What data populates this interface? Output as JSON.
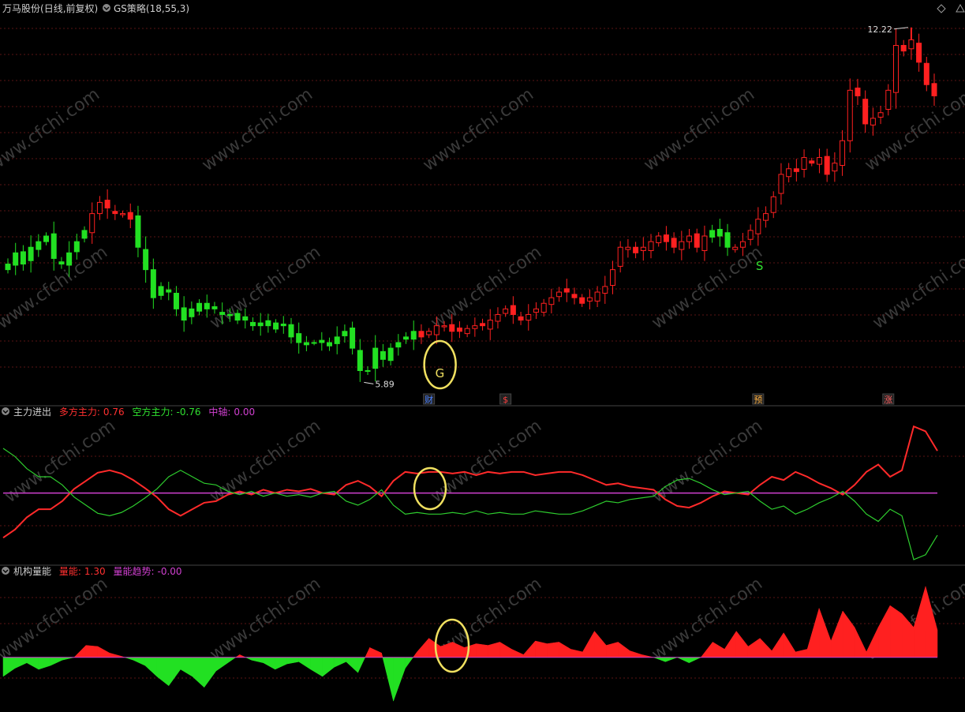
{
  "colors": {
    "up": "#ff2020",
    "down": "#22e022",
    "text": "#cfcfcf",
    "magenta": "#d040d0",
    "grid": "#5a1414",
    "circle": "#f0e060",
    "watermark": "#3a3a3a"
  },
  "header": {
    "stock_name": "万马股份",
    "period": "(日线,前复权)",
    "indicator_name": "GS策略",
    "indicator_params": "(18,55,3)"
  },
  "price_pane": {
    "high_label": "12.22",
    "low_label": "5.89",
    "signal_g": "G",
    "signal_s": "S",
    "event_markers": [
      {
        "label": "财",
        "day": 55
      },
      {
        "label": "$",
        "day": 65
      },
      {
        "label": "预",
        "day": 98
      },
      {
        "label": "涨",
        "day": 115
      }
    ]
  },
  "pane2": {
    "title": "主力进出",
    "items": [
      {
        "label": "多方主力:",
        "value": "0.76",
        "color": "#ff3030"
      },
      {
        "label": "空方主力:",
        "value": "-0.76",
        "color": "#30e030"
      },
      {
        "label": "中轴:",
        "value": "0.00",
        "color": "#d040d0"
      }
    ]
  },
  "pane3": {
    "title": "机构量能",
    "items": [
      {
        "label": "量能:",
        "value": "1.30",
        "color": "#ff3030"
      },
      {
        "label": "量能趋势:",
        "value": "-0.00",
        "color": "#d040d0"
      }
    ]
  },
  "watermark": "www.cfchi.com",
  "chart_data": [
    {
      "type": "candlestick",
      "title": "GS策略(18,55,3)",
      "series": [
        {
          "name": "close",
          "values": [
            8.0,
            8.2,
            8.0,
            8.3,
            8.4,
            8.5,
            8.1,
            8.0,
            8.2,
            8.4,
            8.6,
            8.9,
            9.1,
            9.0,
            8.9,
            8.9,
            8.8,
            8.3,
            7.9,
            7.4,
            7.6,
            7.5,
            7.2,
            7.0,
            7.2,
            7.3,
            7.2,
            7.2,
            7.1,
            7.1,
            7.0,
            7.0,
            6.9,
            6.95,
            6.9,
            6.95,
            6.9,
            6.7,
            6.6,
            6.6,
            6.6,
            6.6,
            6.6,
            6.7,
            6.8,
            6.5,
            6.1,
            6.1,
            6.5,
            6.3,
            6.5,
            6.6,
            6.7,
            6.8,
            6.7,
            6.8,
            6.9,
            6.9,
            6.8,
            6.8,
            6.85,
            6.9,
            6.9,
            7.0,
            7.1,
            7.2,
            7.1,
            7.0,
            7.1,
            7.2,
            7.3,
            7.4,
            7.5,
            7.5,
            7.4,
            7.3,
            7.4,
            7.5,
            7.6,
            7.9,
            8.3,
            8.3,
            8.2,
            8.3,
            8.4,
            8.5,
            8.4,
            8.3,
            8.4,
            8.5,
            8.3,
            8.5,
            8.6,
            8.5,
            8.3,
            8.3,
            8.4,
            8.6,
            8.8,
            8.9,
            9.2,
            9.6,
            9.7,
            9.65,
            9.9,
            9.8,
            9.9,
            9.6,
            9.8,
            10.2,
            11.1,
            11.0,
            10.5,
            10.6,
            10.7,
            11.1,
            11.9,
            11.8,
            12.0,
            11.6,
            11.2,
            11.0
          ]
        },
        {
          "name": "signal",
          "values": [
            "down",
            "down",
            "down",
            "down",
            "down",
            "down",
            "down",
            "down",
            "down",
            "down",
            "down",
            "up",
            "up",
            "up",
            "up",
            "up",
            "up",
            "down",
            "down",
            "down",
            "down",
            "down",
            "down",
            "down",
            "down",
            "down",
            "down",
            "down",
            "down",
            "down",
            "down",
            "down",
            "down",
            "down",
            "down",
            "down",
            "down",
            "down",
            "down",
            "down",
            "down",
            "down",
            "down",
            "down",
            "down",
            "down",
            "down",
            "down",
            "down",
            "down",
            "down",
            "down",
            "down",
            "down",
            "up",
            "up",
            "up",
            "up",
            "up",
            "up",
            "up",
            "up",
            "up",
            "up",
            "up",
            "up",
            "up",
            "up",
            "up",
            "up",
            "up",
            "up",
            "up",
            "up",
            "up",
            "up",
            "up",
            "up",
            "up",
            "up",
            "up",
            "up",
            "up",
            "up",
            "up",
            "up",
            "up",
            "up",
            "up",
            "up",
            "up",
            "up",
            "down",
            "down",
            "down",
            "up",
            "up",
            "up",
            "up",
            "up",
            "up",
            "up",
            "up",
            "up",
            "up",
            "up",
            "up",
            "up",
            "up",
            "up",
            "up",
            "up",
            "up",
            "up",
            "up",
            "up",
            "up",
            "up",
            "up",
            "up",
            "up",
            "up"
          ]
        }
      ],
      "ylim": [
        5.6,
        12.4
      ],
      "high": 12.22,
      "low": 5.89
    },
    {
      "type": "line",
      "title": "主力进出",
      "series": [
        {
          "name": "多方主力",
          "values": [
            -0.55,
            -0.45,
            -0.3,
            -0.2,
            -0.2,
            -0.1,
            0.05,
            0.15,
            0.25,
            0.28,
            0.24,
            0.16,
            0.06,
            -0.05,
            -0.2,
            -0.28,
            -0.2,
            -0.12,
            -0.1,
            -0.02,
            0.02,
            -0.02,
            0.04,
            0.0,
            0.04,
            0.02,
            0.05,
            0.0,
            -0.02,
            0.1,
            0.15,
            0.08,
            -0.04,
            0.15,
            0.26,
            0.24,
            0.26,
            0.26,
            0.24,
            0.26,
            0.22,
            0.26,
            0.24,
            0.26,
            0.26,
            0.22,
            0.24,
            0.26,
            0.26,
            0.22,
            0.16,
            0.1,
            0.12,
            0.08,
            0.06,
            0.04,
            -0.08,
            -0.16,
            -0.18,
            -0.12,
            -0.04,
            0.02,
            0.0,
            -0.02,
            0.1,
            0.2,
            0.16,
            0.26,
            0.2,
            0.12,
            0.06,
            -0.02,
            0.1,
            0.26,
            0.35,
            0.2,
            0.28,
            0.82,
            0.76,
            0.52
          ]
        }
      ],
      "ylim": [
        -0.85,
        0.9
      ]
    },
    {
      "type": "area",
      "title": "机构量能",
      "series": [
        {
          "name": "量能",
          "values": [
            -0.35,
            -0.2,
            -0.1,
            -0.22,
            -0.15,
            -0.05,
            0.0,
            0.22,
            0.2,
            0.08,
            0.02,
            -0.05,
            -0.15,
            -0.35,
            -0.52,
            -0.22,
            -0.35,
            -0.55,
            -0.25,
            -0.1,
            0.05,
            -0.05,
            -0.1,
            -0.22,
            -0.12,
            -0.08,
            -0.22,
            -0.35,
            -0.18,
            -0.08,
            -0.28,
            0.18,
            0.08,
            -0.8,
            -0.2,
            0.1,
            0.35,
            0.2,
            0.28,
            0.18,
            0.25,
            0.22,
            0.28,
            0.15,
            0.05,
            0.3,
            0.25,
            0.28,
            0.15,
            0.1,
            0.48,
            0.22,
            0.28,
            0.12,
            0.05,
            0.0,
            -0.08,
            0.0,
            -0.1,
            0.0,
            0.28,
            0.15,
            0.48,
            0.2,
            0.35,
            0.12,
            0.45,
            0.1,
            0.15,
            0.9,
            0.3,
            0.85,
            0.55,
            0.1,
            0.55,
            0.95,
            0.8,
            0.55,
            1.3,
            0.5
          ]
        }
      ],
      "ylim": [
        -0.9,
        1.4
      ]
    }
  ]
}
